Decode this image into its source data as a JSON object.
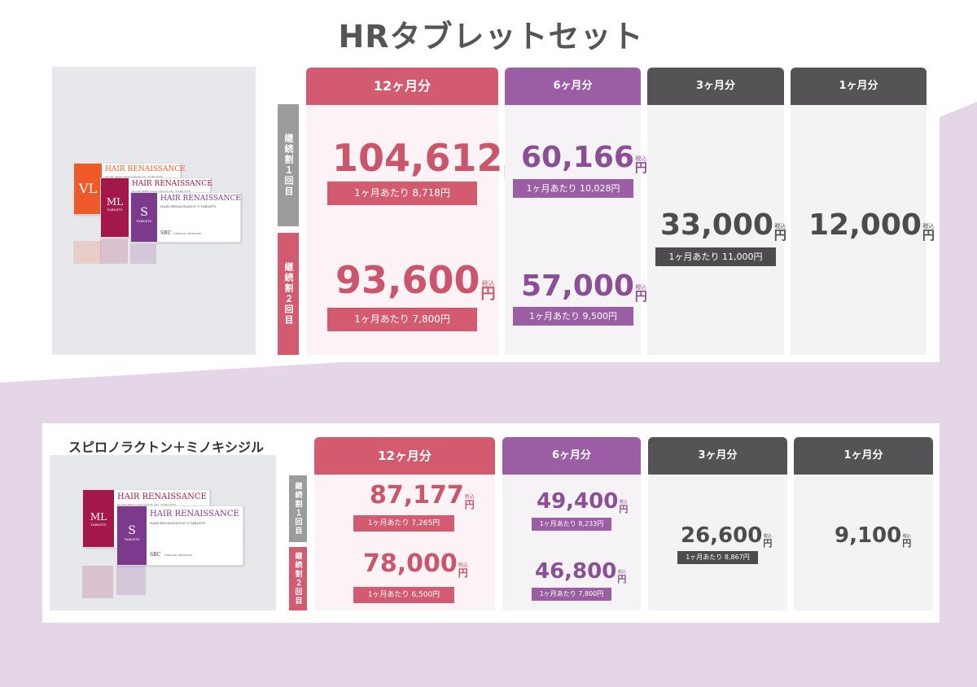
{
  "colors": {
    "background_lavender": "#e4d6e6",
    "red": "#d35b70",
    "purple": "#9b5da4",
    "dark": "#555355",
    "side_gray": "#9c9c9c"
  },
  "section1": {
    "title": "HRタブレットセット",
    "product_art": {
      "box_vl": {
        "code": "VL",
        "brand": "HAIR RENAISSANCE",
        "line": "HAIR RENAISSANCE VL TABLETS"
      },
      "box_ml": {
        "code": "ML",
        "sub": "TABLETS",
        "brand": "HAIR RENAISSANCE",
        "line": "HAIR RENAISSANCE ML TABLETS"
      },
      "box_s": {
        "code": "S",
        "sub": "TABLETS",
        "brand": "HAIR RENAISSANCE",
        "line": "HAIR RENAISSANCE S TABLETS",
        "maker": "SBC",
        "maker_sub": "ORIGINAL MEDICINE"
      }
    },
    "side_labels": {
      "first": "継続割１回目",
      "second": "継続割２回目"
    },
    "columns": [
      {
        "header": "12ヶ月分",
        "first": {
          "price": "104,612",
          "per_month": "1ヶ月あたり 8,718円"
        },
        "second": {
          "price": "93,600",
          "per_month": "1ヶ月あたり 7,800円"
        }
      },
      {
        "header": "6ヶ月分",
        "first": {
          "price": "60,166",
          "per_month": "1ヶ月あたり 10,028円"
        },
        "second": {
          "price": "57,000",
          "per_month": "1ヶ月あたり 9,500円"
        }
      },
      {
        "header": "3ヶ月分",
        "single": {
          "price": "33,000",
          "per_month": "1ヶ月あたり 11,000円"
        }
      },
      {
        "header": "1ヶ月分",
        "single": {
          "price": "12,000"
        }
      }
    ]
  },
  "section2": {
    "title": "スピロノラクトン＋ミノキシジル",
    "product_art": {
      "box_ml": {
        "code": "ML",
        "sub": "TABLETS",
        "brand": "HAIR RENAISSANCE",
        "line": "HAIR RENAISSANCE ML TABLETS"
      },
      "box_s": {
        "code": "S",
        "sub": "TABLETS",
        "brand": "HAIR RENAISSANCE",
        "line": "HAIR RENAISSANCE S TABLETS",
        "maker": "SBC",
        "maker_sub": "ORIGINAL MEDICINE"
      }
    },
    "side_labels": {
      "first": "継続割１回目",
      "second": "継続割２回目"
    },
    "columns": [
      {
        "header": "12ヶ月分",
        "first": {
          "price": "87,177",
          "per_month": "1ヶ月あたり 7,265円"
        },
        "second": {
          "price": "78,000",
          "per_month": "1ヶ月あたり 6,500円"
        }
      },
      {
        "header": "6ヶ月分",
        "first": {
          "price": "49,400",
          "per_month": "1ヶ月あたり 8,233円"
        },
        "second": {
          "price": "46,800",
          "per_month": "1ヶ月あたり 7,800円"
        }
      },
      {
        "header": "3ヶ月分",
        "single": {
          "price": "26,600",
          "per_month": "1ヶ月あたり 8,867円"
        }
      },
      {
        "header": "1ヶ月分",
        "single": {
          "price": "9,100"
        }
      }
    ]
  },
  "units": {
    "tax": "税込",
    "yen": "円"
  }
}
